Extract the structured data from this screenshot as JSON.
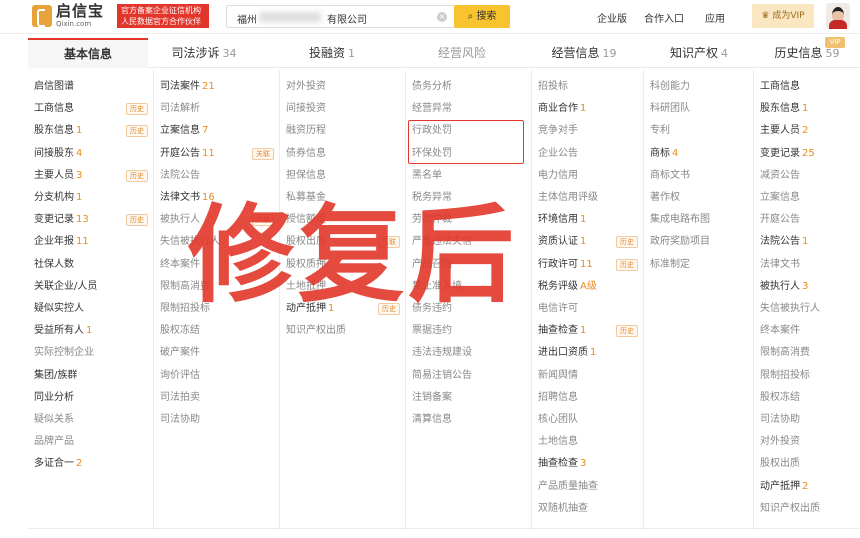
{
  "header": {
    "logo_cn": "启信宝",
    "logo_en": "Qixin.com",
    "badge_line1": "官方备案企业征信机构",
    "badge_line2": "人民数据官方合作伙伴",
    "search_value": "福州",
    "search_value_tail": "有限公司",
    "search_button": "搜索",
    "nav": [
      "企业版",
      "合作入口",
      "应用"
    ],
    "vip_button": "成为VIP"
  },
  "tabs": [
    {
      "label": "基本信息",
      "count": ""
    },
    {
      "label": "司法涉诉",
      "count": "34"
    },
    {
      "label": "投融资",
      "count": "1"
    },
    {
      "label": "经营风险",
      "count": ""
    },
    {
      "label": "经营信息",
      "count": "19"
    },
    {
      "label": "知识产权",
      "count": "4"
    },
    {
      "label": "历史信息",
      "count": "59"
    }
  ],
  "vip_tag": "VIP",
  "columns": [
    [
      {
        "label": "启信图谱",
        "count": "",
        "hist": "",
        "dark": true
      },
      {
        "label": "工商信息",
        "count": "",
        "hist": "历史",
        "dark": true
      },
      {
        "label": "股东信息",
        "count": "1",
        "hist": "历史",
        "dark": true
      },
      {
        "label": "间接股东",
        "count": "4",
        "hist": "",
        "dark": true
      },
      {
        "label": "主要人员",
        "count": "3",
        "hist": "历史",
        "dark": true
      },
      {
        "label": "分支机构",
        "count": "1",
        "hist": "",
        "dark": true
      },
      {
        "label": "变更记录",
        "count": "13",
        "hist": "历史",
        "dark": true
      },
      {
        "label": "企业年报",
        "count": "11",
        "hist": "",
        "dark": true
      },
      {
        "label": "社保人数",
        "count": "",
        "hist": "",
        "dark": true
      },
      {
        "label": "关联企业/人员",
        "count": "",
        "hist": "",
        "dark": true
      },
      {
        "label": "疑似实控人",
        "count": "",
        "hist": "",
        "dark": true
      },
      {
        "label": "受益所有人",
        "count": "1",
        "hist": "",
        "dark": true
      },
      {
        "label": "实际控制企业",
        "count": "",
        "hist": "",
        "dark": false
      },
      {
        "label": "集团/族群",
        "count": "",
        "hist": "",
        "dark": true
      },
      {
        "label": "同业分析",
        "count": "",
        "hist": "",
        "dark": true
      },
      {
        "label": "疑似关系",
        "count": "",
        "hist": "",
        "dark": false
      },
      {
        "label": "品牌产品",
        "count": "",
        "hist": "",
        "dark": false
      },
      {
        "label": "多证合一",
        "count": "2",
        "hist": "",
        "dark": true
      }
    ],
    [
      {
        "label": "司法案件",
        "count": "21",
        "hist": "",
        "dark": true
      },
      {
        "label": "司法解析",
        "count": "",
        "hist": "",
        "dark": false
      },
      {
        "label": "立案信息",
        "count": "7",
        "hist": "",
        "dark": true
      },
      {
        "label": "开庭公告",
        "count": "11",
        "hist": "关联",
        "dark": true
      },
      {
        "label": "法院公告",
        "count": "",
        "hist": "",
        "dark": false
      },
      {
        "label": "法律文书",
        "count": "16",
        "hist": "",
        "dark": true
      },
      {
        "label": "被执行人",
        "count": "",
        "hist": "关联",
        "dark": false
      },
      {
        "label": "失信被执行人",
        "count": "",
        "hist": "",
        "dark": false
      },
      {
        "label": "终本案件",
        "count": "",
        "hist": "",
        "dark": false
      },
      {
        "label": "限制高消费",
        "count": "",
        "hist": "",
        "dark": false
      },
      {
        "label": "限制招投标",
        "count": "",
        "hist": "",
        "dark": false
      },
      {
        "label": "股权冻结",
        "count": "",
        "hist": "",
        "dark": false
      },
      {
        "label": "破产案件",
        "count": "",
        "hist": "",
        "dark": false
      },
      {
        "label": "询价评估",
        "count": "",
        "hist": "",
        "dark": false
      },
      {
        "label": "司法拍卖",
        "count": "",
        "hist": "",
        "dark": false
      },
      {
        "label": "司法协助",
        "count": "",
        "hist": "",
        "dark": false
      }
    ],
    [
      {
        "label": "对外投资",
        "count": "",
        "hist": "",
        "dark": false
      },
      {
        "label": "间接投资",
        "count": "",
        "hist": "",
        "dark": false
      },
      {
        "label": "融资历程",
        "count": "",
        "hist": "",
        "dark": false
      },
      {
        "label": "债券信息",
        "count": "",
        "hist": "",
        "dark": false
      },
      {
        "label": "担保信息",
        "count": "",
        "hist": "",
        "dark": false
      },
      {
        "label": "私募基金",
        "count": "",
        "hist": "",
        "dark": false
      },
      {
        "label": "授信额度",
        "count": "",
        "hist": "",
        "dark": false
      },
      {
        "label": "股权出质",
        "count": "",
        "hist": "关联",
        "dark": false
      },
      {
        "label": "股权质押",
        "count": "",
        "hist": "",
        "dark": false
      },
      {
        "label": "土地抵押",
        "count": "",
        "hist": "",
        "dark": false
      },
      {
        "label": "动产抵押",
        "count": "1",
        "hist": "历史",
        "dark": true
      },
      {
        "label": "知识产权出质",
        "count": "",
        "hist": "",
        "dark": false
      }
    ],
    [
      {
        "label": "债务分析",
        "count": "",
        "hist": "",
        "dark": false
      },
      {
        "label": "经营异常",
        "count": "",
        "hist": "",
        "dark": false
      },
      {
        "label": "行政处罚",
        "count": "",
        "hist": "",
        "dark": false
      },
      {
        "label": "环保处罚",
        "count": "",
        "hist": "",
        "dark": false
      },
      {
        "label": "黑名单",
        "count": "",
        "hist": "",
        "dark": false
      },
      {
        "label": "税务异常",
        "count": "",
        "hist": "",
        "dark": false
      },
      {
        "label": "劳动仲裁",
        "count": "",
        "hist": "",
        "dark": false
      },
      {
        "label": "严重违法失信",
        "count": "",
        "hist": "",
        "dark": false
      },
      {
        "label": "产品召回",
        "count": "",
        "hist": "",
        "dark": false
      },
      {
        "label": "禁止准入境",
        "count": "",
        "hist": "",
        "dark": false
      },
      {
        "label": "债务违约",
        "count": "",
        "hist": "",
        "dark": false
      },
      {
        "label": "票据违约",
        "count": "",
        "hist": "",
        "dark": false
      },
      {
        "label": "违法违规建设",
        "count": "",
        "hist": "",
        "dark": false
      },
      {
        "label": "简易注销公告",
        "count": "",
        "hist": "",
        "dark": false
      },
      {
        "label": "注销备案",
        "count": "",
        "hist": "",
        "dark": false
      },
      {
        "label": "清算信息",
        "count": "",
        "hist": "",
        "dark": false
      }
    ],
    [
      {
        "label": "招投标",
        "count": "",
        "hist": "",
        "dark": false
      },
      {
        "label": "商业合作",
        "count": "1",
        "hist": "",
        "dark": true
      },
      {
        "label": "竞争对手",
        "count": "",
        "hist": "",
        "dark": false
      },
      {
        "label": "企业公告",
        "count": "",
        "hist": "",
        "dark": false
      },
      {
        "label": "电力信用",
        "count": "",
        "hist": "",
        "dark": false
      },
      {
        "label": "主体信用评级",
        "count": "",
        "hist": "",
        "dark": false
      },
      {
        "label": "环境信用",
        "count": "1",
        "hist": "",
        "dark": true
      },
      {
        "label": "资质认证",
        "count": "1",
        "hist": "历史",
        "dark": true
      },
      {
        "label": "行政许可",
        "count": "11",
        "hist": "历史",
        "dark": true
      },
      {
        "label": "税务评级",
        "count": "A级",
        "hist": "",
        "dark": true
      },
      {
        "label": "电信许可",
        "count": "",
        "hist": "",
        "dark": false
      },
      {
        "label": "抽查检查",
        "count": "1",
        "hist": "历史",
        "dark": true
      },
      {
        "label": "进出口资质",
        "count": "1",
        "hist": "",
        "dark": true
      },
      {
        "label": "新闻舆情",
        "count": "",
        "hist": "",
        "dark": false
      },
      {
        "label": "招聘信息",
        "count": "",
        "hist": "",
        "dark": false
      },
      {
        "label": "核心团队",
        "count": "",
        "hist": "",
        "dark": false
      },
      {
        "label": "土地信息",
        "count": "",
        "hist": "",
        "dark": false
      },
      {
        "label": "抽查检查",
        "count": "3",
        "hist": "",
        "dark": true
      },
      {
        "label": "产品质量抽查",
        "count": "",
        "hist": "",
        "dark": false
      },
      {
        "label": "双随机抽查",
        "count": "",
        "hist": "",
        "dark": false
      }
    ],
    [
      {
        "label": "科创能力",
        "count": "",
        "hist": "",
        "dark": false
      },
      {
        "label": "科研团队",
        "count": "",
        "hist": "",
        "dark": false
      },
      {
        "label": "专利",
        "count": "",
        "hist": "",
        "dark": false
      },
      {
        "label": "商标",
        "count": "4",
        "hist": "",
        "dark": true
      },
      {
        "label": "商标文书",
        "count": "",
        "hist": "",
        "dark": false
      },
      {
        "label": "著作权",
        "count": "",
        "hist": "",
        "dark": false
      },
      {
        "label": "集成电路布图",
        "count": "",
        "hist": "",
        "dark": false
      },
      {
        "label": "政府奖励项目",
        "count": "",
        "hist": "",
        "dark": false
      },
      {
        "label": "标准制定",
        "count": "",
        "hist": "",
        "dark": false
      }
    ],
    [
      {
        "label": "工商信息",
        "count": "",
        "hist": "",
        "dark": true
      },
      {
        "label": "股东信息",
        "count": "1",
        "hist": "",
        "dark": true
      },
      {
        "label": "主要人员",
        "count": "2",
        "hist": "",
        "dark": true
      },
      {
        "label": "变更记录",
        "count": "25",
        "hist": "",
        "dark": true
      },
      {
        "label": "减资公告",
        "count": "",
        "hist": "",
        "dark": false
      },
      {
        "label": "立案信息",
        "count": "",
        "hist": "",
        "dark": false
      },
      {
        "label": "开庭公告",
        "count": "",
        "hist": "",
        "dark": false
      },
      {
        "label": "法院公告",
        "count": "1",
        "hist": "",
        "dark": true
      },
      {
        "label": "法律文书",
        "count": "",
        "hist": "",
        "dark": false
      },
      {
        "label": "被执行人",
        "count": "3",
        "hist": "",
        "dark": true
      },
      {
        "label": "失信被执行人",
        "count": "",
        "hist": "",
        "dark": false
      },
      {
        "label": "终本案件",
        "count": "",
        "hist": "",
        "dark": false
      },
      {
        "label": "限制高消费",
        "count": "",
        "hist": "",
        "dark": false
      },
      {
        "label": "限制招投标",
        "count": "",
        "hist": "",
        "dark": false
      },
      {
        "label": "股权冻结",
        "count": "",
        "hist": "",
        "dark": false
      },
      {
        "label": "司法协助",
        "count": "",
        "hist": "",
        "dark": false
      },
      {
        "label": "对外投资",
        "count": "",
        "hist": "",
        "dark": false
      },
      {
        "label": "股权出质",
        "count": "",
        "hist": "",
        "dark": false
      },
      {
        "label": "动产抵押",
        "count": "2",
        "hist": "",
        "dark": true
      },
      {
        "label": "知识产权出质",
        "count": "",
        "hist": "",
        "dark": false
      }
    ]
  ],
  "watermark": "修复后",
  "colors": {
    "accent": "#e2362b",
    "count": "#e78e1e",
    "search_button": "#f7c32e"
  }
}
